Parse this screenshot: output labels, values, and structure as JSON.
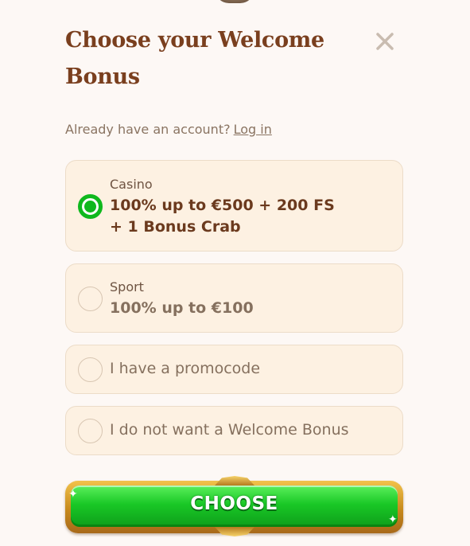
{
  "modal": {
    "title": "Choose your Welcome Bonus",
    "account_prompt": "Already have an account?",
    "login_link": "Log in"
  },
  "options": [
    {
      "sub": "Casino",
      "main": "100% up to €500 + 200 FS + 1 Bonus Crab",
      "selected": true
    },
    {
      "sub": "Sport",
      "main": "100% up to €100",
      "selected": false
    },
    {
      "main": "I have a promocode",
      "selected": false
    },
    {
      "main": "I do not want a Welcome Bonus",
      "selected": false
    }
  ],
  "cta": {
    "label": "CHOOSE"
  },
  "colors": {
    "accent_green": "#0fb81d",
    "title_brown": "#7a3f1e",
    "card_bg": "#fdf1e2"
  }
}
